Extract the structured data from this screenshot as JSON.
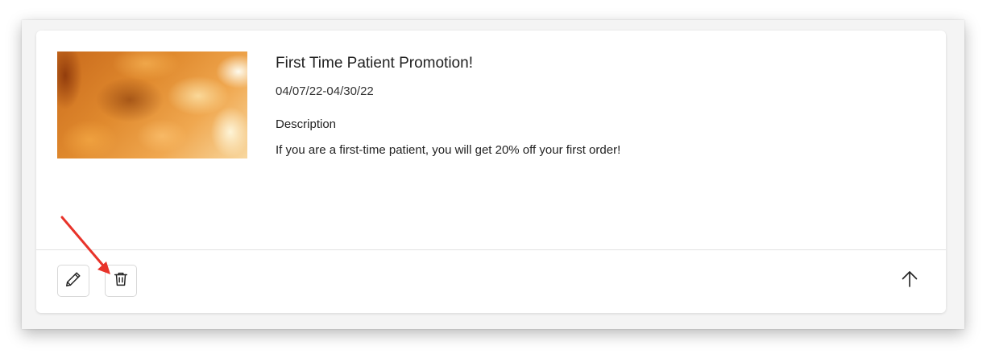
{
  "promotion": {
    "image_alt": "Promotion banner image",
    "title": "First Time Patient Promotion!",
    "date_range": "04/07/22-04/30/22",
    "description_label": "Description",
    "description_text": "If you are a first-time patient, you will get 20% off your first order!"
  },
  "actions": {
    "edit_icon": "pencil-icon",
    "delete_icon": "trash-icon",
    "collapse_icon": "arrow-up-icon"
  },
  "colors": {
    "annotation_arrow": "#e8332a",
    "card_background": "#ffffff",
    "window_background": "#f4f4f4"
  }
}
